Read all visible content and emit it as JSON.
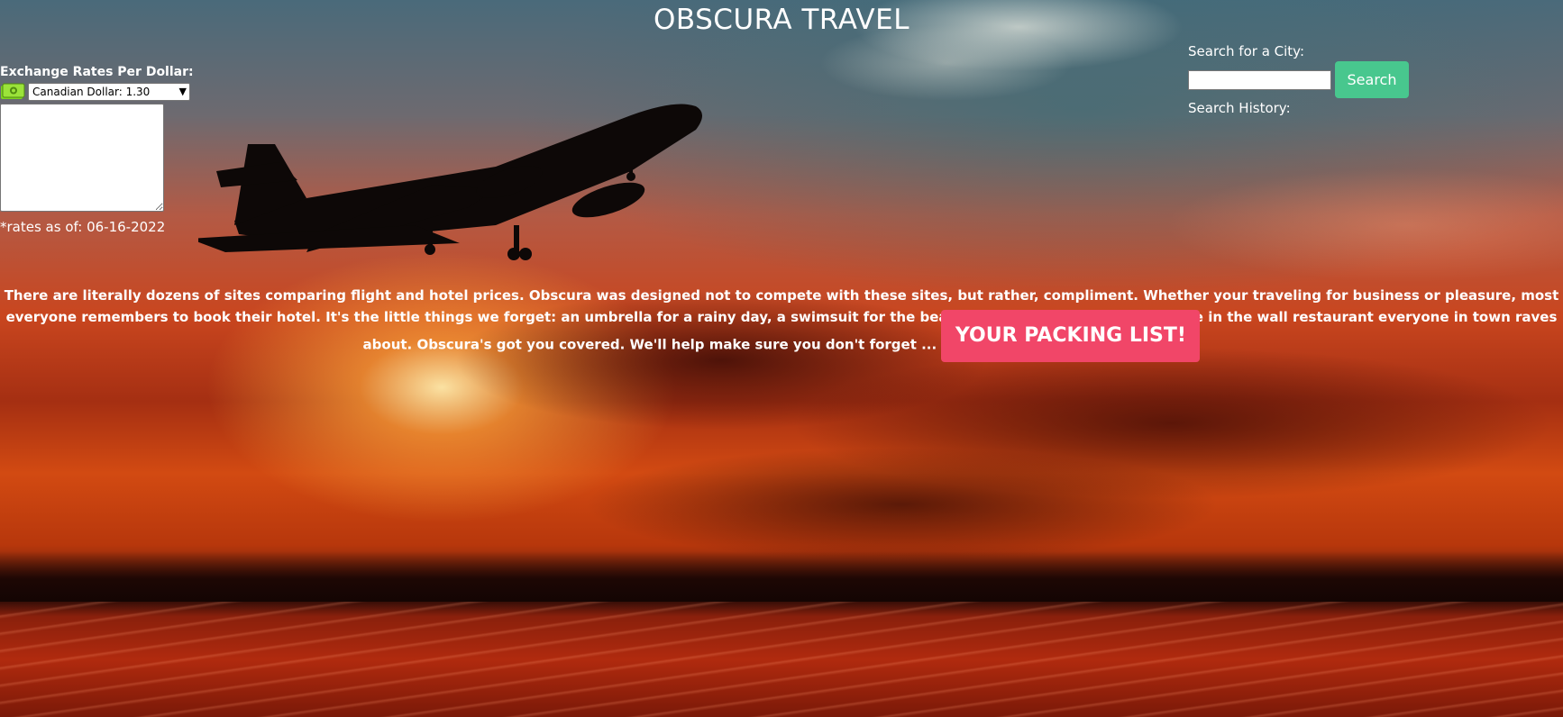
{
  "header": {
    "title": "OBSCURA TRAVEL"
  },
  "exchange": {
    "label": "Exchange Rates Per Dollar:",
    "icon": "money-icon",
    "selected_option": "Canadian Dollar: 1.30",
    "rates_note": "*rates as of: 06-16-2022"
  },
  "search": {
    "label": "Search for a City:",
    "input_value": "",
    "button_label": "Search",
    "history_label": "Search History:"
  },
  "intro": {
    "text": "There are literally dozens of sites comparing flight and hotel prices. Obscura was designed not to compete with these sites, but rather, compliment. Whether your traveling for business or pleasure, most everyone remembers to book their hotel. It's the little things we forget: an umbrella for a rainy day, a swimsuit for the beach, or local currency for that hole in the wall restaurant everyone in town raves about. Obscura's got you covered. We'll help make sure you don't forget ...",
    "button_label": "YOUR PACKING LIST!"
  },
  "colors": {
    "search_button": "#48c78e",
    "packing_button": "#f14668",
    "money_icon": "#7ed321"
  }
}
